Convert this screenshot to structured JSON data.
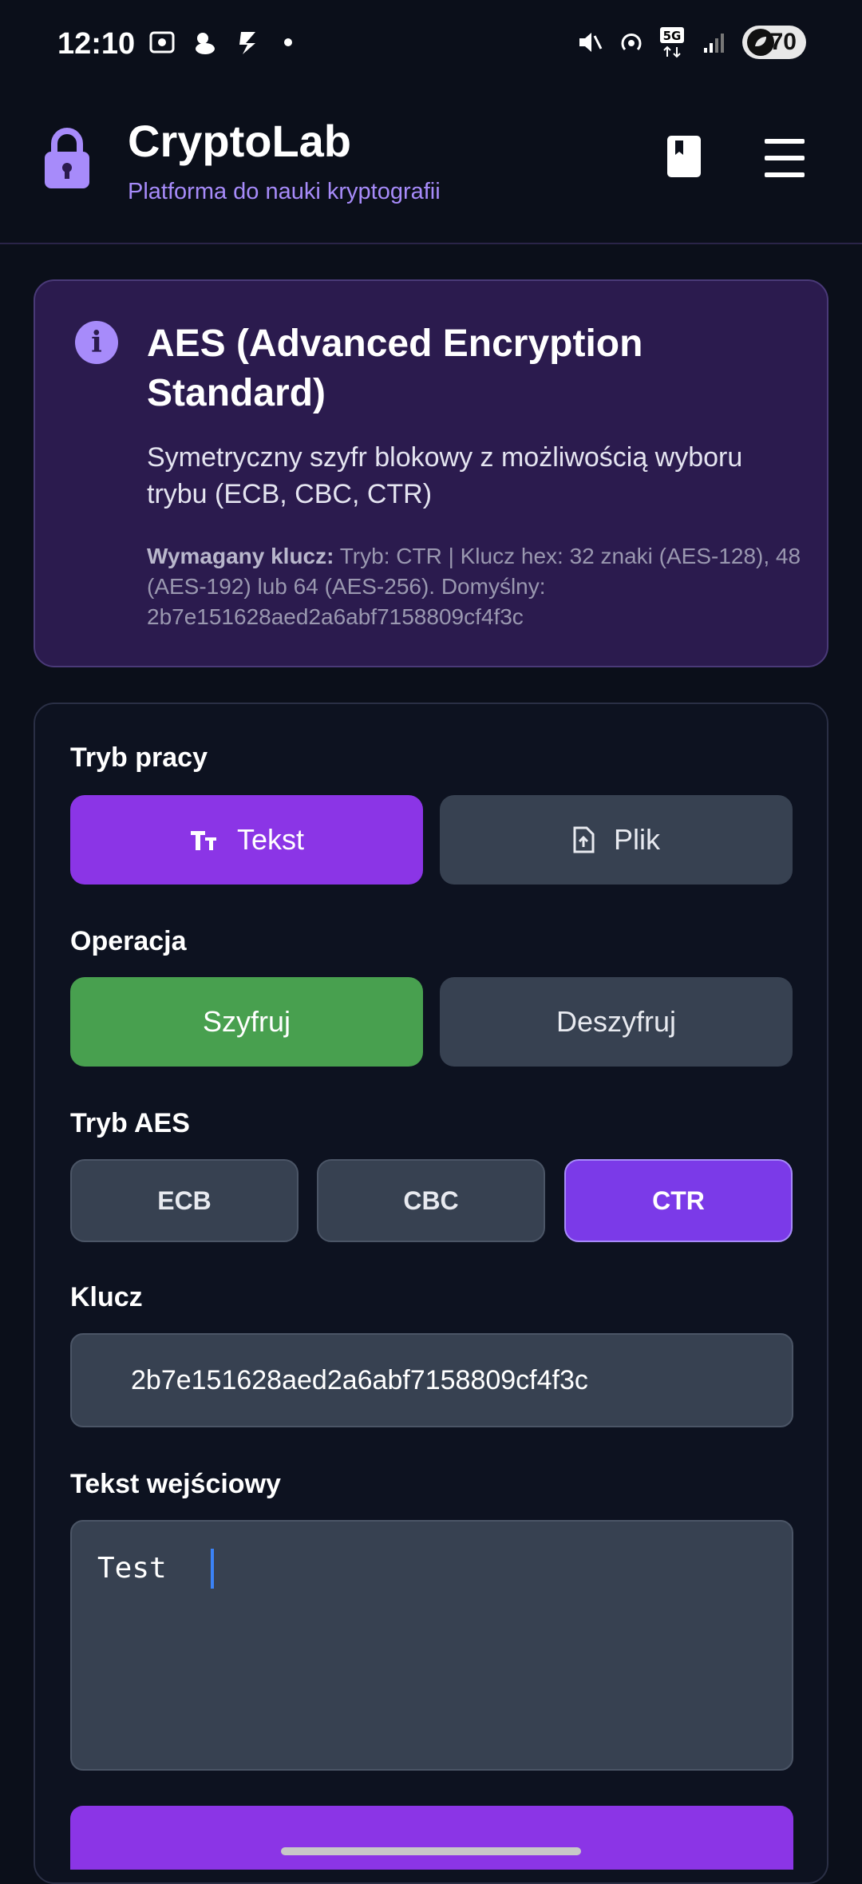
{
  "status_bar": {
    "time": "12:10",
    "battery": "70",
    "network": "5G"
  },
  "header": {
    "title": "CryptoLab",
    "subtitle": "Platforma do nauki kryptografii"
  },
  "info": {
    "title": "AES (Advanced Encryption Standard)",
    "description": "Symetryczny szyfr blokowy z możliwością wyboru trybu (ECB, CBC, CTR)",
    "key_label": "Wymagany klucz:",
    "key_text": " Tryb: CTR | Klucz hex: 32 znaki (AES-128), 48 (AES-192) lub 64 (AES-256). Domyślny: 2b7e151628aed2a6abf7158809cf4f3c"
  },
  "form": {
    "mode_label": "Tryb pracy",
    "mode_text": "Tekst",
    "mode_file": "Plik",
    "operation_label": "Operacja",
    "encrypt": "Szyfruj",
    "decrypt": "Deszyfruj",
    "aes_mode_label": "Tryb AES",
    "aes_modes": [
      "ECB",
      "CBC",
      "CTR"
    ],
    "selected_aes_mode": "CTR",
    "key_label": "Klucz",
    "key_value": "2b7e151628aed2a6abf7158809cf4f3c",
    "input_label": "Tekst wejściowy",
    "input_value": "Test"
  },
  "colors": {
    "accent_purple": "#8b35e6",
    "accent_green": "#48a04f",
    "info_bg": "#2b1b4e",
    "subtitle": "#a78bfa"
  },
  "icons": [
    "lock-icon",
    "book-icon",
    "hamburger-menu-icon",
    "info-icon",
    "text-format-icon",
    "file-upload-icon"
  ]
}
